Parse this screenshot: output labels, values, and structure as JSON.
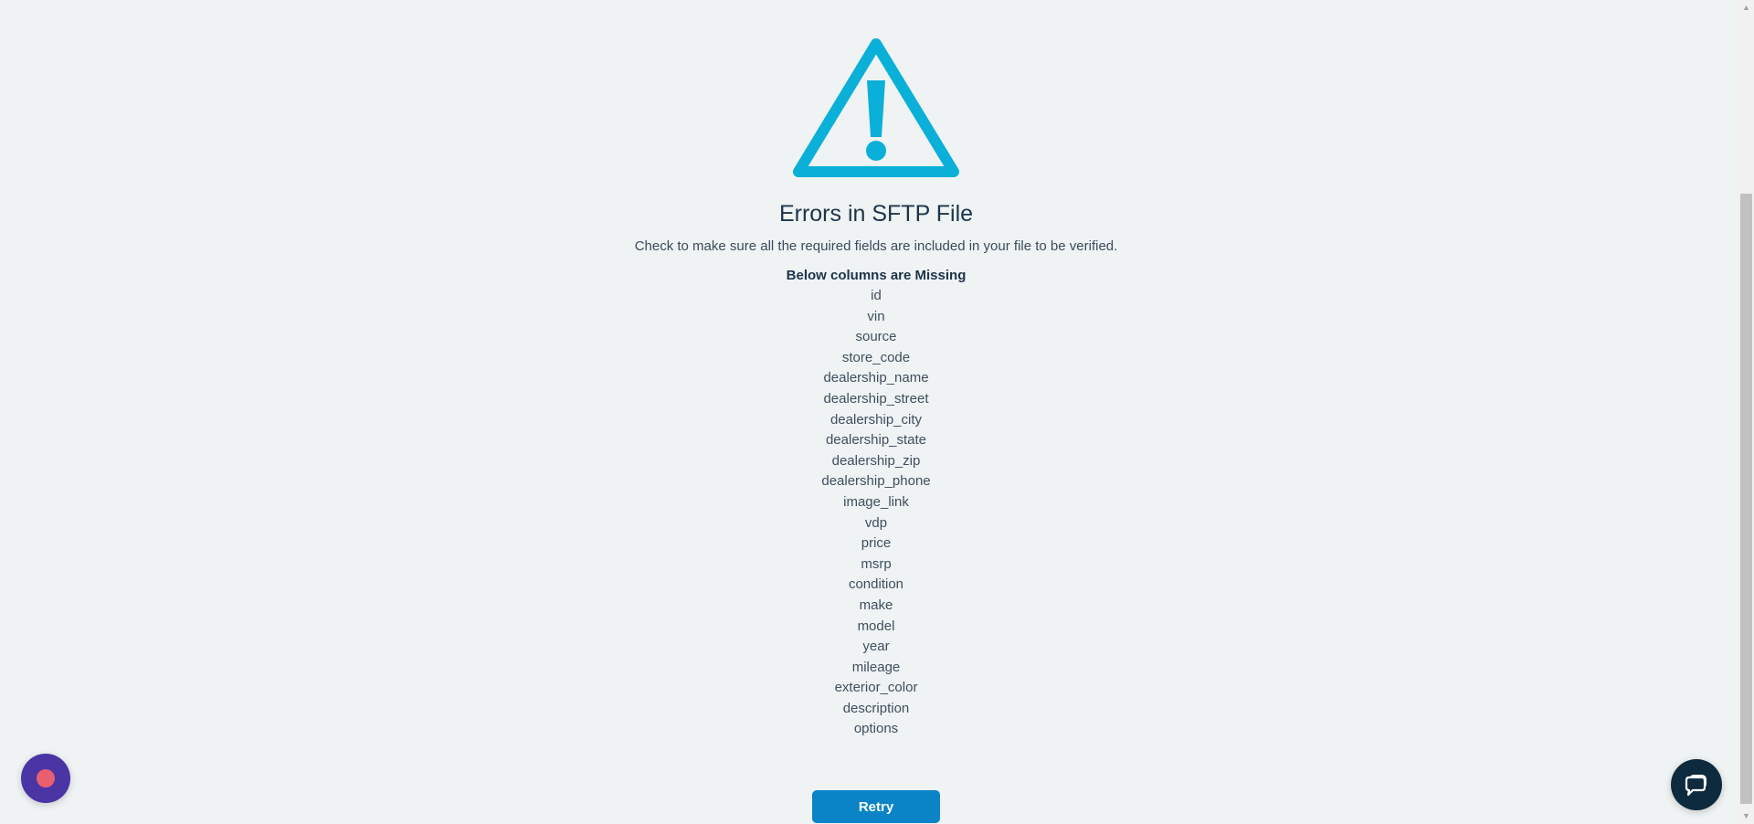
{
  "error": {
    "title": "Errors in SFTP File",
    "subtitle": "Check to make sure all the required fields are included in your file to be verified.",
    "missing_heading": "Below columns are Missing",
    "missing_columns": [
      "id",
      "vin",
      "source",
      "store_code",
      "dealership_name",
      "dealership_street",
      "dealership_city",
      "dealership_state",
      "dealership_zip",
      "dealership_phone",
      "image_link",
      "vdp",
      "price",
      "msrp",
      "condition",
      "make",
      "model",
      "year",
      "mileage",
      "exterior_color",
      "description",
      "options"
    ]
  },
  "actions": {
    "retry_label": "Retry"
  },
  "icons": {
    "warning": "warning-triangle-icon",
    "chat": "chat-bubble-icon",
    "bot": "bot-launcher-icon"
  },
  "colors": {
    "accent": "#0ab0d8",
    "button": "#0a84c6",
    "background": "#eff3f4",
    "title_text": "#1d3448",
    "bot_launcher": "#4b35a5",
    "chat_launcher": "#0d2a3e"
  }
}
